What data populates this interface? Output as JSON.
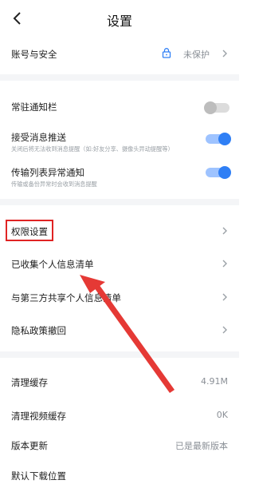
{
  "header": {
    "title": "设置"
  },
  "account": {
    "label": "账号与安全",
    "status": "未保护"
  },
  "notify_bar": {
    "label": "常驻通知栏",
    "enabled": false
  },
  "push": {
    "label": "接受消息推送",
    "desc": "关闭后将无法收到消息提醒（如:好友分享、摄像头异动提醒等）",
    "enabled": true
  },
  "transfer": {
    "label": "传输列表异常通知",
    "desc": "传输或备份异常时会收到消息提醒",
    "enabled": true
  },
  "permissions": {
    "label": "权限设置"
  },
  "collected": {
    "label": "已收集个人信息清单"
  },
  "shared": {
    "label": "与第三方共享个人信息清单"
  },
  "privacy": {
    "label": "隐私政策撤回"
  },
  "cache": {
    "label": "清理缓存",
    "value": "4.91M"
  },
  "video_cache": {
    "label": "清理视频缓存",
    "value": "0K"
  },
  "version": {
    "label": "版本更新",
    "value": "已是最新版本"
  },
  "download": {
    "label": "默认下载位置"
  },
  "colors": {
    "accent": "#2f7ff5",
    "highlight": "#e02424",
    "arrow": "#e53935"
  }
}
